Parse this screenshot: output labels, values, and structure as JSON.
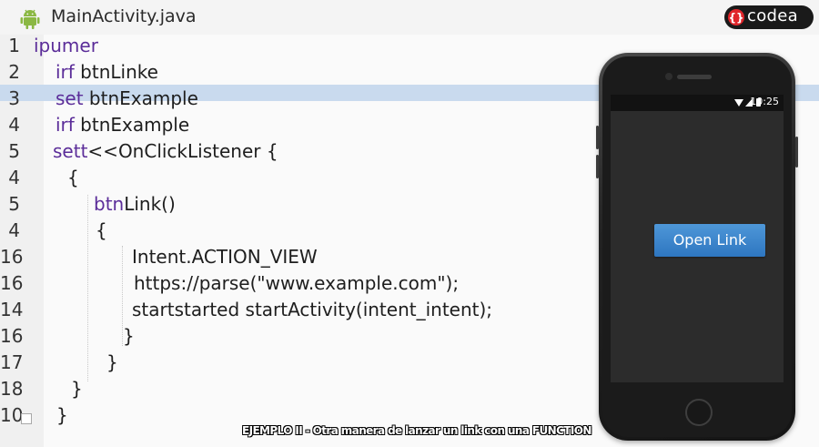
{
  "editor": {
    "filename": "MainActivity.java",
    "brand": "codea",
    "highlighted_line_index": 2,
    "lines": [
      {
        "num": "1",
        "kw": "ipumer",
        "text": ""
      },
      {
        "num": "2",
        "kw": "irf",
        "text": " btnLinke"
      },
      {
        "num": "3",
        "kw": "set",
        "text": " btnExample"
      },
      {
        "num": "4",
        "kw": "irf",
        "text": " btnExample"
      },
      {
        "num": "5",
        "kw": "sett",
        "text": "<<OnClickListener {"
      },
      {
        "num": "4",
        "kw": "",
        "text": "{"
      },
      {
        "num": "5",
        "kw": "btn",
        "text": "Link()"
      },
      {
        "num": "4",
        "kw": "",
        "text": "{"
      },
      {
        "num": "16",
        "kw": "",
        "text": "Intent.ACTION_VIEW"
      },
      {
        "num": "16",
        "kw": "",
        "text": "https://parse(\"www.example.com\");"
      },
      {
        "num": "14",
        "kw": "",
        "text": "startstarted startActivity(intent_intent);"
      },
      {
        "num": "16",
        "kw": "",
        "text": "}"
      },
      {
        "num": "17",
        "kw": "",
        "text": "}"
      },
      {
        "num": "18",
        "kw": "",
        "text": "}"
      },
      {
        "num": "10",
        "kw": "",
        "text": "}"
      }
    ]
  },
  "phone": {
    "time": "10:25",
    "button_label": "Open Link"
  },
  "caption": "EJEMPLO II - Otra manera de lanzar un link con una FUNCTION",
  "colors": {
    "keyword": "#5b2d99",
    "highlight": "#c9daee",
    "button": "#3a86cf",
    "android": "#8bb843"
  },
  "icons": [
    "android-icon",
    "codea-logo-icon",
    "wifi-icon",
    "signal-icon",
    "battery-icon"
  ]
}
